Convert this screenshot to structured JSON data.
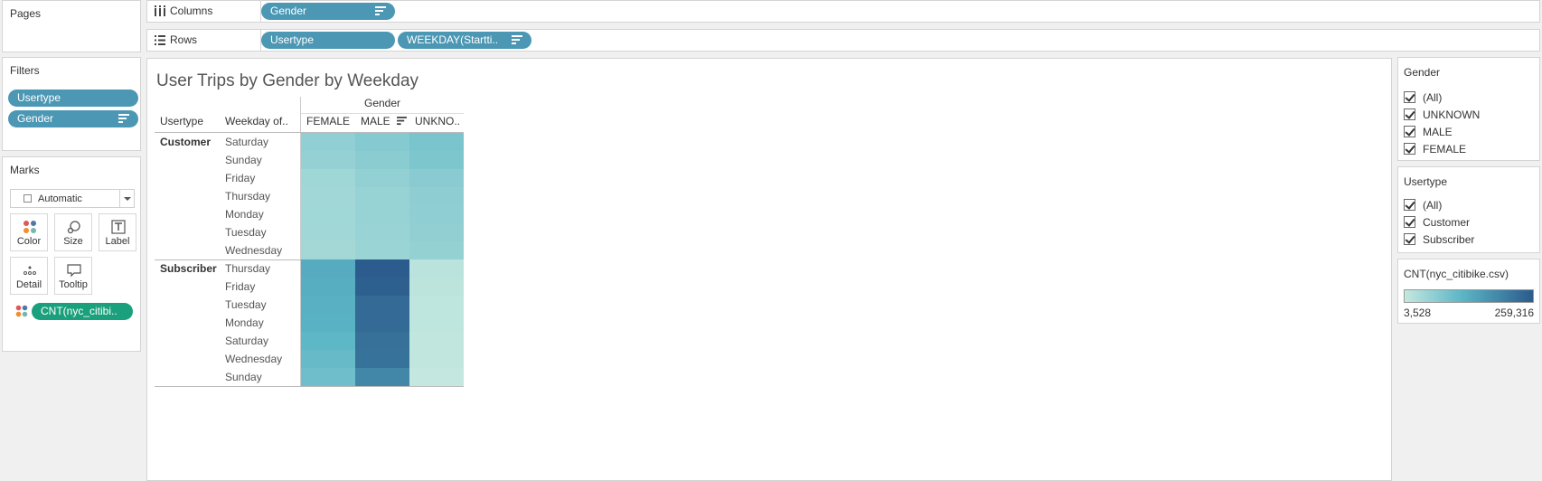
{
  "pages": {
    "title": "Pages"
  },
  "filters": {
    "title": "Filters",
    "items": [
      "Usertype",
      "Gender"
    ]
  },
  "marks": {
    "title": "Marks",
    "type": "Automatic",
    "buttons": [
      "Color",
      "Size",
      "Label",
      "Detail",
      "Tooltip"
    ],
    "field": "CNT(nyc_citibi.."
  },
  "columns": {
    "label": "Columns",
    "pills": [
      "Gender"
    ]
  },
  "rows": {
    "label": "Rows",
    "pills": [
      "Usertype",
      "WEEKDAY(Startti.."
    ]
  },
  "viz": {
    "title": "User Trips by Gender by Weekday",
    "col_group_header": "Gender",
    "row_headers": [
      "Usertype",
      "Weekday of.."
    ],
    "columns": [
      "FEMALE",
      "MALE",
      "UNKNO.."
    ]
  },
  "chart_data": {
    "type": "heatmap",
    "title": "User Trips by Gender by Weekday",
    "x_group": "Gender",
    "x": [
      "FEMALE",
      "MALE",
      "UNKNO.."
    ],
    "groups": [
      {
        "name": "Customer",
        "rows": [
          "Saturday",
          "Sunday",
          "Friday",
          "Thursday",
          "Monday",
          "Tuesday",
          "Wednesday"
        ],
        "values": [
          [
            16000,
            22000,
            30000
          ],
          [
            14000,
            19000,
            27000
          ],
          [
            10000,
            15000,
            20000
          ],
          [
            9000,
            13000,
            17000
          ],
          [
            9500,
            13000,
            16500
          ],
          [
            9000,
            12000,
            15500
          ],
          [
            8500,
            11500,
            14500
          ]
        ]
      },
      {
        "name": "Subscriber",
        "rows": [
          "Thursday",
          "Friday",
          "Tuesday",
          "Monday",
          "Saturday",
          "Wednesday",
          "Sunday"
        ],
        "values": [
          [
            70000,
            255000,
            4000
          ],
          [
            66000,
            245000,
            3800
          ],
          [
            62000,
            215000,
            3700
          ],
          [
            60000,
            212000,
            3700
          ],
          [
            52000,
            195000,
            3600
          ],
          [
            44000,
            192000,
            3600
          ],
          [
            38000,
            140000,
            3528
          ]
        ]
      }
    ],
    "color_range": [
      3528,
      259316
    ],
    "color_low": "#c4e8df",
    "color_high": "#2b5b8c"
  },
  "gender_filter": {
    "title": "Gender",
    "options": [
      "(All)",
      "UNKNOWN",
      "MALE",
      "FEMALE"
    ]
  },
  "usertype_filter": {
    "title": "Usertype",
    "options": [
      "(All)",
      "Customer",
      "Subscriber"
    ]
  },
  "legend": {
    "title": "CNT(nyc_citibike.csv)",
    "min": "3,528",
    "max": "259,316"
  }
}
